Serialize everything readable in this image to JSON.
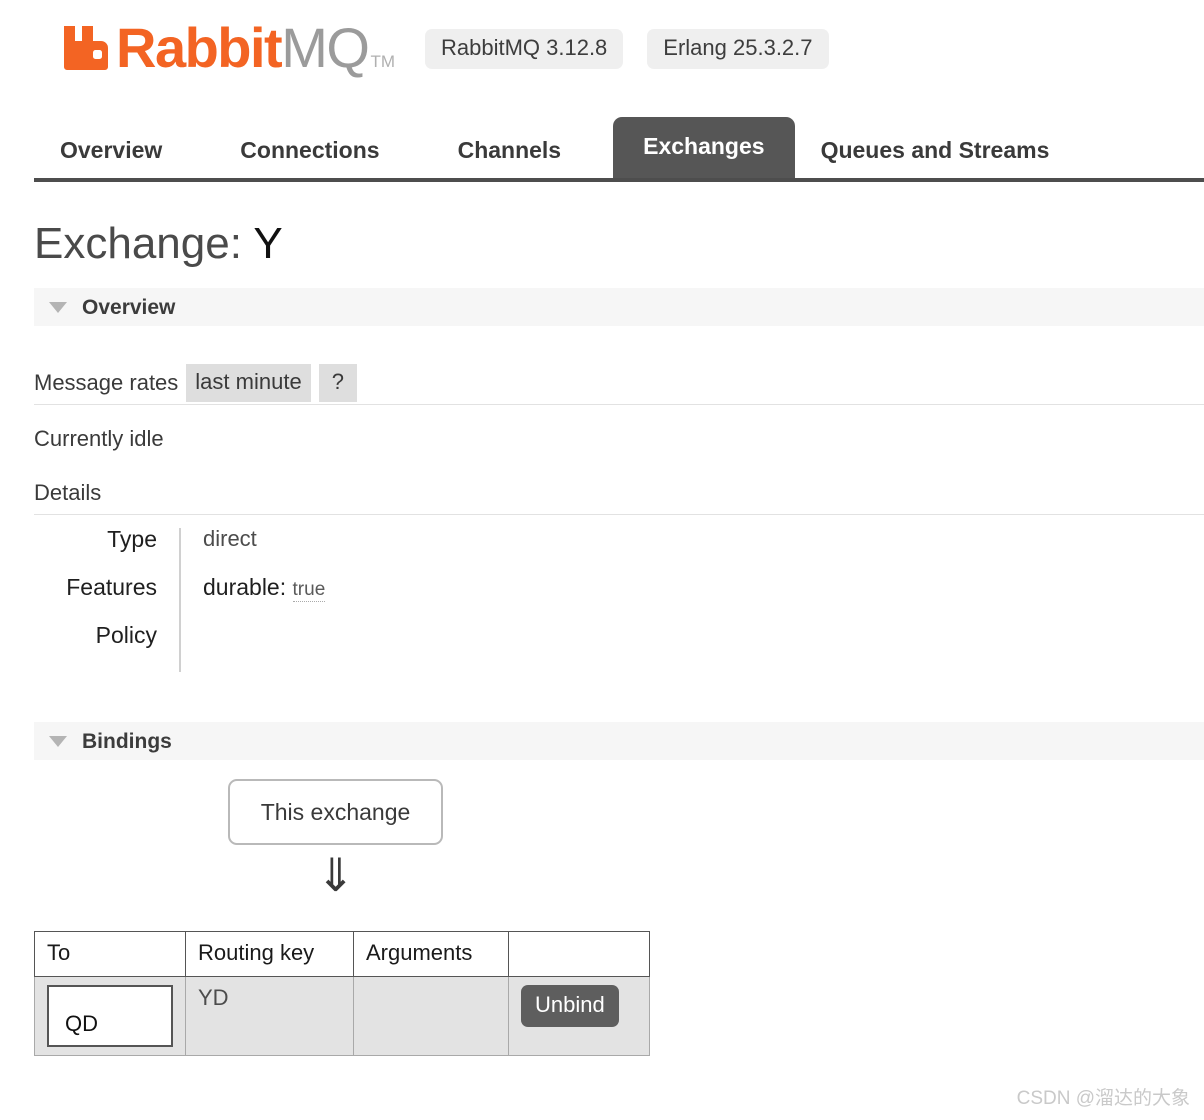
{
  "header": {
    "logo_rabbit": "Rabbit",
    "logo_mq": "MQ",
    "logo_tm": "TM",
    "logo_icon": "rabbit-logo-icon",
    "brand_color": "#F36423",
    "badges": [
      {
        "label": "RabbitMQ 3.12.8"
      },
      {
        "label": "Erlang 25.3.2.7"
      }
    ]
  },
  "nav": {
    "tabs": [
      {
        "label": "Overview",
        "active": false
      },
      {
        "label": "Connections",
        "active": false
      },
      {
        "label": "Channels",
        "active": false
      },
      {
        "label": "Exchanges",
        "active": true
      },
      {
        "label": "Queues and Streams",
        "active": false
      }
    ],
    "active_tab": "Exchanges",
    "active_bg": "#565656"
  },
  "page": {
    "title_prefix": "Exchange:",
    "title_value": "Y"
  },
  "overview": {
    "section_label": "Overview",
    "rates_label": "Message rates",
    "rates_period": "last minute",
    "help_label": "?",
    "idle_text": "Currently idle",
    "details_label": "Details",
    "details": [
      {
        "key": "Type",
        "value": "direct"
      },
      {
        "key": "Features",
        "feature_name": "durable:",
        "feature_value": "true"
      },
      {
        "key": "Policy",
        "value": ""
      }
    ]
  },
  "bindings": {
    "section_label": "Bindings",
    "source_label": "This exchange",
    "arrow_glyph": "⇓",
    "columns": [
      "To",
      "Routing key",
      "Arguments",
      ""
    ],
    "rows": [
      {
        "to": "QD",
        "routing_key": "YD",
        "arguments": "",
        "action_label": "Unbind"
      }
    ]
  },
  "watermark": {
    "text": "CSDN @溜达的大象"
  }
}
